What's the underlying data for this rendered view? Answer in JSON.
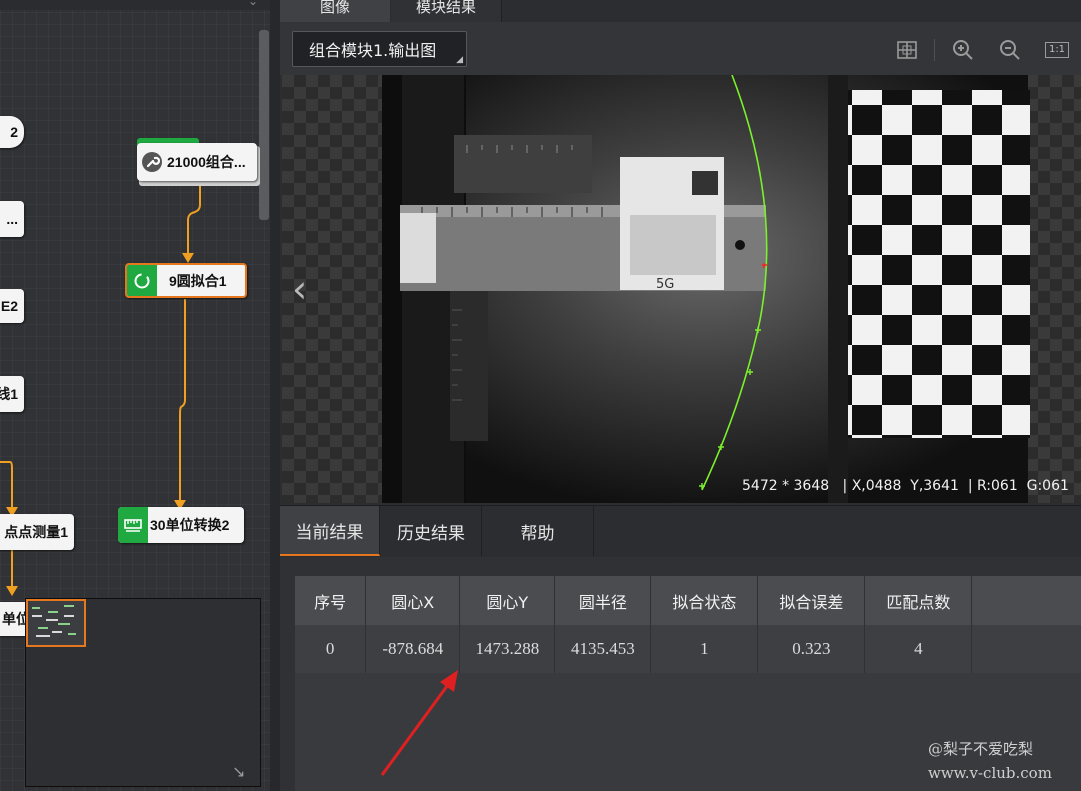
{
  "tabs": {
    "image": "图像",
    "module_result": "模块结果"
  },
  "image_select": {
    "value": "组合模块1.输出图"
  },
  "toolbar_icons": [
    "grid-icon",
    "zoom-in-icon",
    "zoom-out-icon",
    "actual-size-icon"
  ],
  "actual_size_label": "1:1",
  "flow": {
    "node_21000": "21000组合...",
    "node_9": "9圆拟合1",
    "node_30": "30单位转换2",
    "partial_1": "2",
    "partial_2": "...",
    "partial_3": "E2",
    "partial_4": "线1",
    "partial_5": "点点测量1",
    "partial_6": "单位"
  },
  "viewer": {
    "resolution": "5472 * 3648",
    "coords": "X,0488  Y,3641",
    "rgb": "R:061  G:061",
    "status_sep": "|",
    "nav_left": "‹",
    "sticker_text": "5G"
  },
  "result_tabs": {
    "current": "当前结果",
    "history": "历史结果",
    "help": "帮助"
  },
  "table": {
    "headers": [
      "序号",
      "圆心X",
      "圆心Y",
      "圆半径",
      "拟合状态",
      "拟合误差",
      "匹配点数"
    ],
    "rows": [
      [
        "0",
        "-878.684",
        "1473.288",
        "4135.453",
        "1",
        "0.323",
        "4"
      ]
    ]
  },
  "watermark": {
    "line1": "@梨子不爱吃梨",
    "line2": "www.v-club.com"
  },
  "colors": {
    "accent_orange": "#e5771e",
    "node_green": "#1fa940",
    "fit_circle": "#7cf02c",
    "annotation_red": "#e02020"
  }
}
